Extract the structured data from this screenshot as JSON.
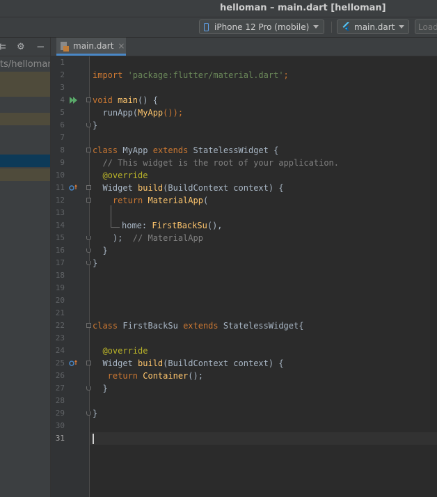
{
  "window": {
    "title": "helloman – main.dart [helloman]"
  },
  "toolbar": {
    "device": "iPhone 12 Pro (mobile)",
    "config": "main.dart",
    "load": "Load"
  },
  "project": {
    "path": "ts/helloman"
  },
  "tab": {
    "label": "main.dart",
    "close": "×"
  },
  "editor": {
    "current_line": 31,
    "line_numbers": [
      "1",
      "2",
      "3",
      "4",
      "5",
      "6",
      "7",
      "8",
      "9",
      "10",
      "11",
      "12",
      "13",
      "14",
      "15",
      "16",
      "17",
      "18",
      "19",
      "20",
      "21",
      "22",
      "23",
      "24",
      "25",
      "26",
      "27",
      "28",
      "29",
      "30",
      "31"
    ]
  },
  "code": {
    "l2_kw": "import ",
    "l2_str": "'package:flutter/material.dart'",
    "l2_end": ";",
    "l4_kw": "void ",
    "l4_fn": "main",
    "l4_end": "() {",
    "l5_a": "  runApp(",
    "l5_fn": "MyApp",
    "l5_end": "());",
    "l6": "}",
    "l8_kw1": "class ",
    "l8_name": "MyApp ",
    "l8_kw2": "extends ",
    "l8_end": "StatelessWidget {",
    "l9_cm": "  // This widget is the root of your application.",
    "l10_ann": "  @override",
    "l11_a": "  Widget ",
    "l11_fn": "build",
    "l11_end": "(BuildContext context) {",
    "l12_kw": "    return ",
    "l12_fn": "MaterialApp",
    "l12_end": "(",
    "l14_a": "home: ",
    "l14_fn": "FirstBackSu",
    "l14_end": "(),",
    "l15_a": "    );  ",
    "l15_cm": "// MaterialApp",
    "l16": "  }",
    "l17": "}",
    "l22_kw1": "class ",
    "l22_name": "FirstBackSu ",
    "l22_kw2": "extends ",
    "l22_end": "StatelessWidget{",
    "l24_ann": "  @override",
    "l25_a": "  Widget ",
    "l25_fn": "build",
    "l25_end": "(BuildContext context) {",
    "l26_kw": "   return ",
    "l26_fn": "Container",
    "l26_end": "();",
    "l27": "  }",
    "l29": "}"
  },
  "colors": {
    "keyword": "#cc7832",
    "string": "#6a8759",
    "function": "#ffc66d",
    "comment": "#808080",
    "annotation": "#bbb529",
    "text": "#a9b7c6",
    "background": "#2b2b2b"
  },
  "icons": {
    "run": "run-gutter-icon",
    "override": "override-gutter-icon",
    "settings": "gear-icon",
    "collapse": "minus-icon",
    "phone": "phone-icon",
    "flutter": "flutter-icon",
    "file": "dart-file-icon"
  }
}
